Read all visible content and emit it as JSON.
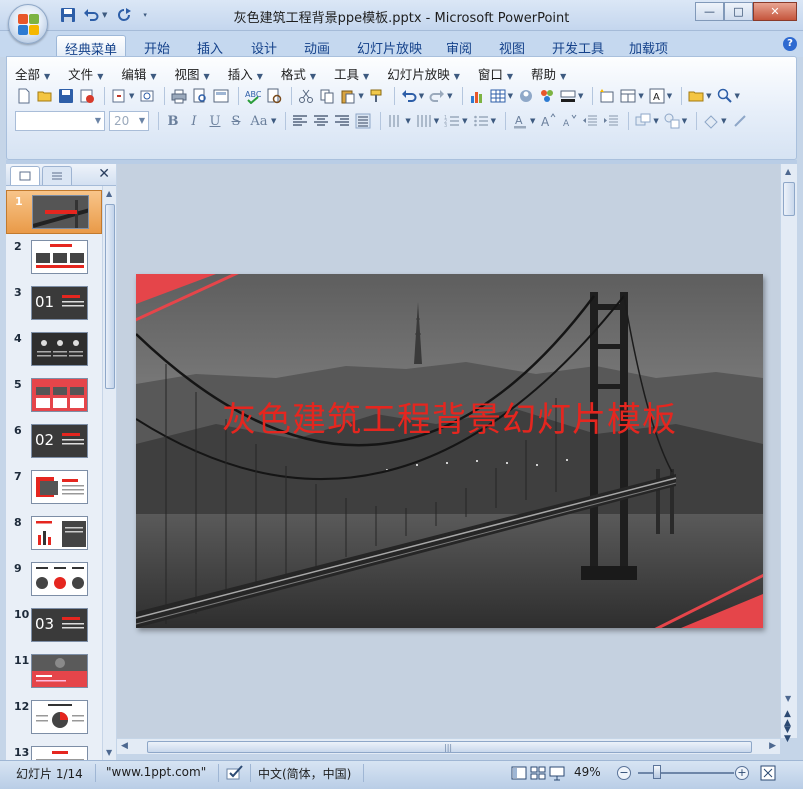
{
  "window": {
    "title": "灰色建筑工程背景ppe模板.pptx - Microsoft PowerPoint",
    "minimize": "—",
    "maximize": "□",
    "close": "✕"
  },
  "ribbon_tabs": [
    {
      "label": "经典菜单",
      "active": true
    },
    {
      "label": "开始"
    },
    {
      "label": "插入"
    },
    {
      "label": "设计"
    },
    {
      "label": "动画"
    },
    {
      "label": "幻灯片放映"
    },
    {
      "label": "审阅"
    },
    {
      "label": "视图"
    },
    {
      "label": "开发工具"
    },
    {
      "label": "加载项"
    }
  ],
  "help_label": "?",
  "menu": [
    {
      "label": "全部"
    },
    {
      "label": "文件"
    },
    {
      "label": "编辑"
    },
    {
      "label": "视图"
    },
    {
      "label": "插入"
    },
    {
      "label": "格式"
    },
    {
      "label": "工具"
    },
    {
      "label": "幻灯片放映"
    },
    {
      "label": "窗口"
    },
    {
      "label": "帮助"
    }
  ],
  "font_size_value": "20",
  "format_buttons": {
    "bold": "B",
    "italic": "I",
    "underline": "U",
    "strike": "S",
    "case": "Aa"
  },
  "slides_panel": {
    "close": "✕",
    "thumbnails": [
      {
        "num": "1",
        "selected": true,
        "kind": "bridge"
      },
      {
        "num": "2",
        "kind": "light-red"
      },
      {
        "num": "3",
        "kind": "dark-num",
        "big": "01"
      },
      {
        "num": "4",
        "kind": "dark-icons"
      },
      {
        "num": "5",
        "kind": "red-cards"
      },
      {
        "num": "6",
        "kind": "dark-num",
        "big": "02"
      },
      {
        "num": "7",
        "kind": "light-red"
      },
      {
        "num": "8",
        "kind": "light-chart"
      },
      {
        "num": "9",
        "kind": "light-circles"
      },
      {
        "num": "10",
        "kind": "dark-num",
        "big": "03"
      },
      {
        "num": "11",
        "kind": "photo-red"
      },
      {
        "num": "12",
        "kind": "light-pie"
      },
      {
        "num": "13",
        "kind": "light-red"
      }
    ]
  },
  "slide": {
    "title": "灰色建筑工程背景幻灯片模板",
    "accent": "#e5261f"
  },
  "status": {
    "slide_info": "幻灯片 1/14",
    "theme": "\"www.1ppt.com\"",
    "language": "中文(简体，中国)",
    "zoom": "49%",
    "zoom_minus": "−",
    "zoom_plus": "+"
  }
}
